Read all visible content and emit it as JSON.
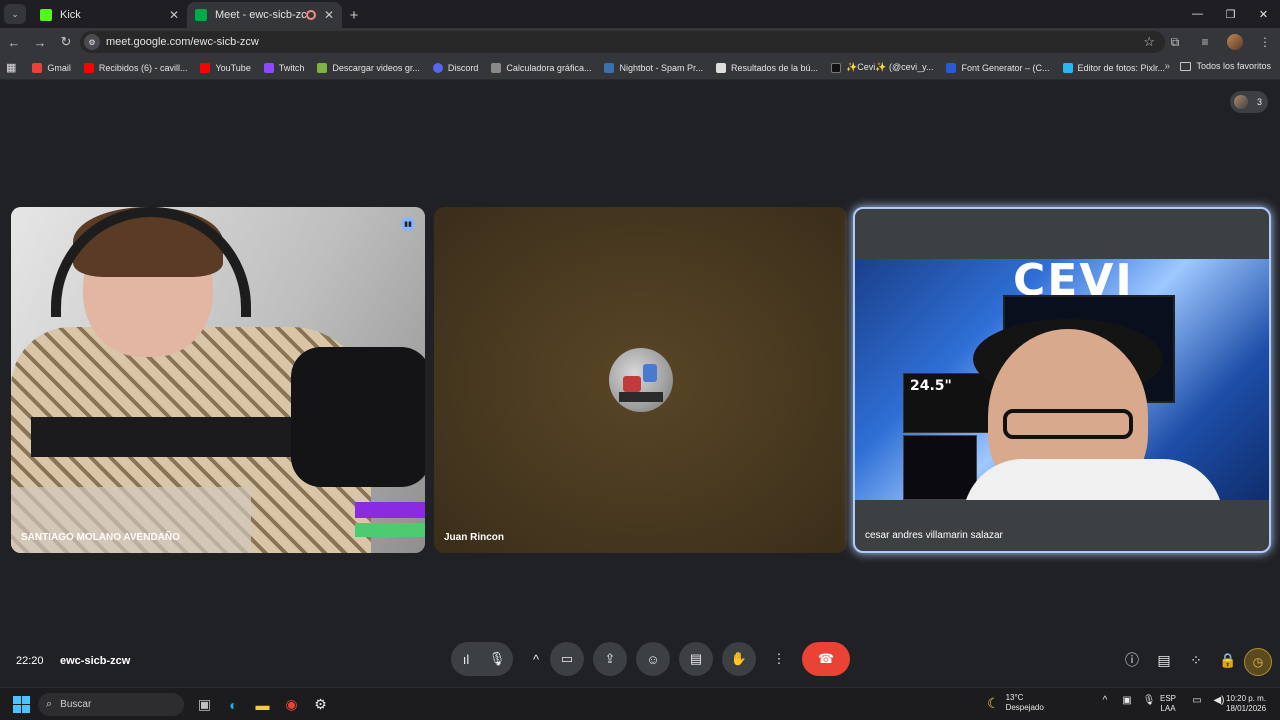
{
  "browser": {
    "tabs": [
      {
        "title": "Kick",
        "favicon_color": "#53fc18"
      },
      {
        "title": "Meet - ewc-sicb-zcw",
        "favicon_color": "#00ac47"
      }
    ],
    "url": "meet.google.com/ewc-sicb-zcw",
    "bookmarks": [
      {
        "label": "Gmail",
        "color": "#ea4335"
      },
      {
        "label": "Recibidos (6) - cavill...",
        "color": "#ff0000"
      },
      {
        "label": "YouTube",
        "color": "#ff0000"
      },
      {
        "label": "Twitch",
        "color": "#9146ff"
      },
      {
        "label": "Descargar videos gr...",
        "color": "#7cb342"
      },
      {
        "label": "Discord",
        "color": "#5865f2"
      },
      {
        "label": "Calculadora gráfica...",
        "color": "#888888"
      },
      {
        "label": "Nightbot - Spam Pr...",
        "color": "#3a6fb0"
      },
      {
        "label": "Resultados de la bú...",
        "color": "#dddddd"
      },
      {
        "label": "✨Cevi✨ (@cevi_y...",
        "color": "#111111"
      },
      {
        "label": "Font Generator – (C...",
        "color": "#2a5bd7"
      },
      {
        "label": "Editor de fotos: Pixlr...",
        "color": "#29b6f6"
      }
    ],
    "all_bookmarks": "Todos los favoritos"
  },
  "meet": {
    "participant_count": "3",
    "participants": [
      {
        "name": "SANTIAGO MOLANO AVENDAÑO"
      },
      {
        "name": "Juan Rincon"
      },
      {
        "name": "cesar andres villamarin salazar"
      }
    ],
    "video_text": {
      "brand": "CEVI",
      "box_label": "24.5\""
    },
    "time": "22:20",
    "meeting_code": "ewc-sicb-zcw"
  },
  "taskbar": {
    "search_placeholder": "Buscar",
    "weather_temp": "13°C",
    "weather_desc": "Despejado",
    "lang_1": "ESP",
    "lang_2": "LAA",
    "clock_time": "10:20 p. m.",
    "clock_date": "18/01/2026"
  }
}
